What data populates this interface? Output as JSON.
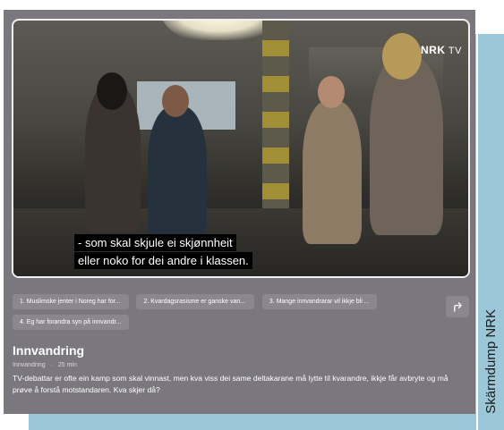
{
  "video": {
    "logo": "NRK",
    "logo_suffix": "TV",
    "subtitles": [
      "- som skal skjule ei skjønnheit",
      "eller noko for dei andre i klassen."
    ]
  },
  "episodes": [
    "1. Muslimske jenter i Noreg har for...",
    "2. Kvardagsrasisme er ganske van...",
    "3. Mange innvandrarar vil ikkje bli ...",
    "4. Eg har forandra syn på innvandr..."
  ],
  "program": {
    "title": "Innvandring",
    "category": "Innvandring",
    "duration": "25 min",
    "separator": "·",
    "description": "TV-debattar er ofte ein kamp som skal vinnast, men kva viss dei same deltakarane må lytte til kvarandre, ikkje får avbryte og må prøve å forstå motstandaren. Kva skjer då?"
  },
  "credit": "Skärmdump NRK",
  "colors": {
    "panel": "#7a777f",
    "chip": "#8a878e",
    "frame": "#9cc7d8"
  }
}
